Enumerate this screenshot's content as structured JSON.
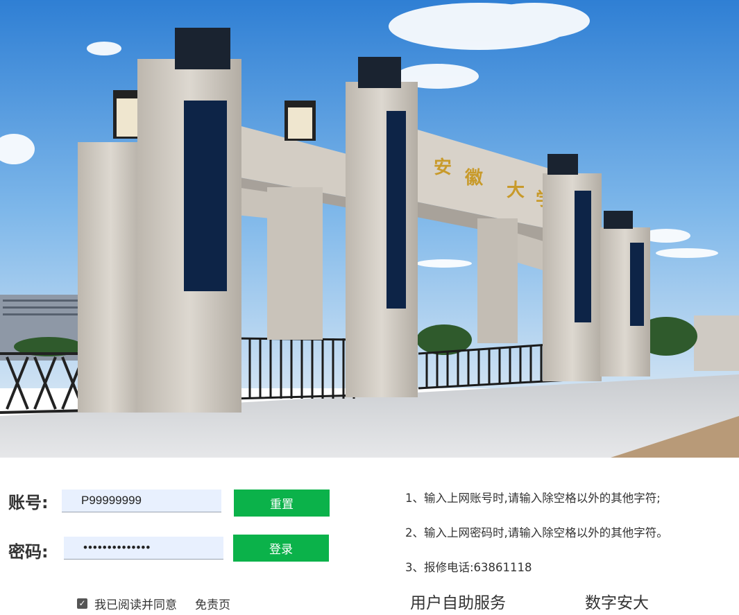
{
  "login": {
    "account_label": "账号:",
    "account_value": "P99999999",
    "password_label": "密码:",
    "password_value": "••••••••••••••",
    "reset_button": "重置",
    "login_button": "登录",
    "agree_text": "我已阅读并同意",
    "disclaimer_link": "免责页"
  },
  "notices": [
    "1、输入上网账号时,请输入除空格以外的其他字符;",
    "2、输入上网密码时,请输入除空格以外的其他字符。",
    "3、报修电话:63861118"
  ],
  "footer": {
    "self_service": "用户自助服务",
    "digital": "数字安大"
  },
  "hero": {
    "gate_inscription": "安徽大学",
    "sky_color": "#4a9be0",
    "stone_color": "#cfc9c1"
  }
}
